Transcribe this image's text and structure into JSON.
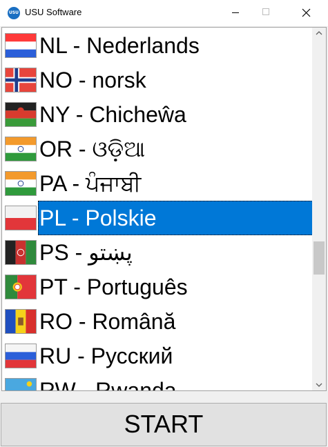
{
  "window": {
    "title": "USU Software",
    "app_icon_text": "USU",
    "controls": [
      "minimize",
      "maximize",
      "close"
    ]
  },
  "languages": [
    {
      "label": "NL - Nederlands",
      "flag": "flag-netherlands-icon"
    },
    {
      "label": "NO - norsk",
      "flag": "flag-norway-icon"
    },
    {
      "label": "NY - Chicheŵa",
      "flag": "flag-malawi-icon"
    },
    {
      "label": "OR - ଓଡ଼ିଆ",
      "flag": "flag-india-icon"
    },
    {
      "label": "PA - ਪੰਜਾਬੀ",
      "flag": "flag-india-icon"
    },
    {
      "label": "PL - Polskie",
      "flag": "flag-poland-icon",
      "selected": true
    },
    {
      "label": "PS - پښتو",
      "flag": "flag-afghanistan-icon"
    },
    {
      "label": "PT - Português",
      "flag": "flag-portugal-icon"
    },
    {
      "label": "RO - Română",
      "flag": "flag-moldova-icon"
    },
    {
      "label": "RU - Русский",
      "flag": "flag-russia-icon"
    },
    {
      "label": "RW - Rwanda",
      "flag": "flag-rwanda-icon"
    }
  ],
  "start_button": {
    "label": "START"
  },
  "colors": {
    "selection": "#0078d7",
    "button_face": "#e1e1e1",
    "window_bg": "#f0f0f0"
  }
}
